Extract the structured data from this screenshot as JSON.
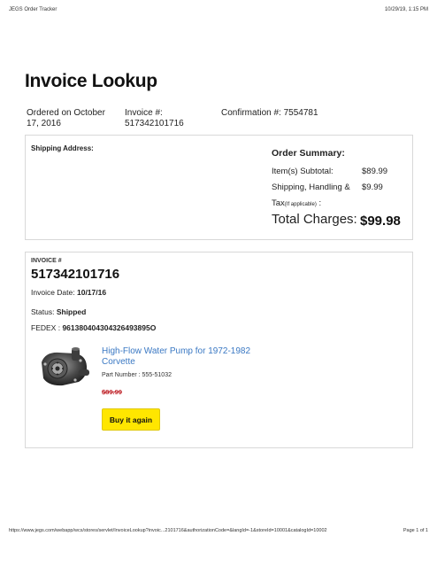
{
  "print_header": {
    "title": "JEGS Order Tracker",
    "datetime": "10/29/19, 1:15 PM"
  },
  "page": {
    "title": "Invoice Lookup"
  },
  "order_meta": {
    "ordered_on": "Ordered on October 17, 2016",
    "invoice": "Invoice #: 517342101716",
    "confirmation": "Confirmation #: 7554781"
  },
  "shipping": {
    "label": "Shipping Address:"
  },
  "summary": {
    "title": "Order Summary:",
    "subtotal_label": "Item(s) Subtotal:",
    "subtotal_value": "$89.99",
    "shipping_label": "Shipping, Handling &",
    "shipping_value": "$9.99",
    "tax_label": "Tax",
    "tax_note": "(If applicable)",
    "tax_suffix": " :",
    "total_label": "Total Charges:",
    "total_value": "$99.98"
  },
  "invoice": {
    "small_label": "INVOICE #",
    "number": "517342101716",
    "date_label": "Invoice Date: ",
    "date_value": "10/17/16",
    "status_label": "Status: ",
    "status_value": "Shipped",
    "fedex_label": "FEDEX : ",
    "fedex_value": "961380404304326493895O"
  },
  "product": {
    "icon": "water-pump-image",
    "name": "High-Flow Water Pump for 1972-1982 Corvette",
    "part_number": "Part Number : 555-51032",
    "price": "$89.99",
    "buy_label": "Buy it again"
  },
  "print_footer": {
    "url": "https://www.jegs.com/webapp/wcs/stores/servlet/InvoiceLookup?invoic...2101716&authorizationCode=&langId=-1&storeId=10001&catalogId=10002",
    "page": "Page 1 of 1"
  },
  "colors": {
    "link": "#3a78c3",
    "price": "#c0272d",
    "button": "#ffe600",
    "border": "#d8d8d8"
  }
}
